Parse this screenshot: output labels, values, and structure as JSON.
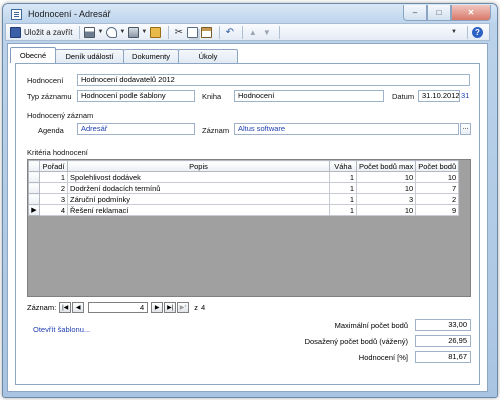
{
  "window": {
    "title": "Hodnocení - Adresář",
    "controls": [
      "–",
      "□",
      "✕"
    ]
  },
  "toolbar": {
    "save_close_label": "Uložit a zavřít",
    "icons": [
      "save-icon",
      "print-icon",
      "preview-icon",
      "fax-icon",
      "attach-icon",
      "cut-icon",
      "copy-icon",
      "paste-icon",
      "undo-icon",
      "up-icon",
      "down-icon",
      "help-icon"
    ]
  },
  "tabs": [
    {
      "label": "Obecné",
      "active": true
    },
    {
      "label": "Deník událostí",
      "active": false
    },
    {
      "label": "Dokumenty",
      "active": false
    },
    {
      "label": "Úkoly",
      "active": false
    }
  ],
  "form": {
    "hodnoceni_label": "Hodnocení",
    "hodnoceni_value": "Hodnocení dodavatelů 2012",
    "typ_label": "Typ záznamu",
    "typ_value": "Hodnocení podle šablony",
    "kniha_label": "Kniha",
    "kniha_value": "Hodnocení",
    "datum_label": "Datum",
    "datum_value": "31.10.2012",
    "calendar_label": "31",
    "section_hodnoceny": "Hodnocený záznam",
    "agenda_label": "Agenda",
    "agenda_value": "Adresář",
    "zaznam_label": "Záznam",
    "zaznam_value": "Altus software",
    "ellipsis": "...",
    "section_kriteria": "Kritéria hodnocení"
  },
  "grid": {
    "columns": [
      "Pořadí",
      "Popis",
      "Váha",
      "Počet bodů max",
      "Počet bodů"
    ],
    "rows": [
      {
        "poradi": "1",
        "popis": "Spolehlivost dodávek",
        "vaha": "1",
        "max": "10",
        "body": "10",
        "current": false
      },
      {
        "poradi": "2",
        "popis": "Dodržení dodacích termínů",
        "vaha": "1",
        "max": "10",
        "body": "7",
        "current": false
      },
      {
        "poradi": "3",
        "popis": "Záruční podmínky",
        "vaha": "1",
        "max": "3",
        "body": "2",
        "current": false
      },
      {
        "poradi": "4",
        "popis": "Řešení reklamací",
        "vaha": "1",
        "max": "10",
        "body": "9",
        "current": true
      }
    ]
  },
  "navigator": {
    "label": "Záznam:",
    "current": "4",
    "of_label": "z",
    "total": "4"
  },
  "footer": {
    "template_link": "Otevřít šablonu...",
    "max_label": "Maximální počet bodů",
    "max_value": "33,00",
    "weighted_label": "Dosažený počet bodů (vážený)",
    "weighted_value": "26,95",
    "percent_label": "Hodnocení [%]",
    "percent_value": "81,67"
  }
}
